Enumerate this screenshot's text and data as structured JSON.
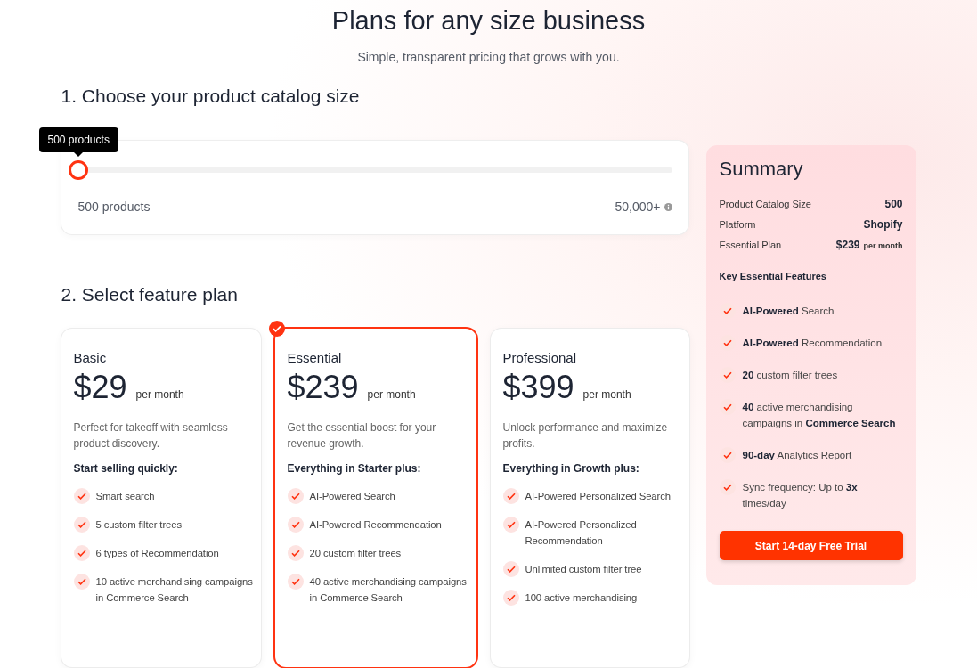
{
  "header": {
    "title": "Plans for any size business",
    "subtitle": "Simple, transparent pricing that grows with you."
  },
  "catalog": {
    "heading": "1. Choose your product catalog size",
    "tooltip": "500 products",
    "level": 0,
    "min_label": "500 products",
    "max_label": "50,000+"
  },
  "plan_section": {
    "heading": "2. Select feature plan"
  },
  "plans": [
    {
      "name": "Basic",
      "price": "$29",
      "period": "per month",
      "description": "Perfect for takeoff with seamless product discovery.",
      "features_title": "Start selling quickly:",
      "selected": false,
      "features": [
        "Smart search",
        "5 custom filter trees",
        "6 types of Recommendation",
        "10 active merchandising campaigns in Commerce Search"
      ]
    },
    {
      "name": "Essential",
      "price": "$239",
      "period": "per month",
      "description": "Get the essential boost for your revenue growth.",
      "features_title": "Everything in Starter plus:",
      "selected": true,
      "features": [
        "AI-Powered Search",
        "AI-Powered Recommendation",
        "20 custom filter trees",
        "40 active merchandising campaigns in Commerce Search"
      ]
    },
    {
      "name": "Professional",
      "price": "$399",
      "period": "per month",
      "description": "Unlock performance and maximize profits.",
      "features_title": "Everything in Growth plus:",
      "selected": false,
      "features": [
        "AI-Powered Personalized Search",
        "AI-Powered Personalized Recommendation",
        "Unlimited custom filter tree",
        "100 active merchandising"
      ]
    }
  ],
  "summary": {
    "title": "Summary",
    "rows": [
      {
        "label": "Product Catalog Size",
        "value": "500"
      },
      {
        "label": "Platform",
        "value": "Shopify"
      },
      {
        "label": "Essential Plan",
        "value": "$239",
        "unit": "per month"
      }
    ],
    "features_title": "Key Essential Features",
    "features": [
      "**AI-Powered** Search",
      "**AI-Powered** Recommendation",
      "**20** custom filter trees",
      "**40** active merchandising campaigns in **Commerce Search**",
      "**90-day** Analytics Report",
      "Sync frequency: Up to **3x** times/day"
    ],
    "button": "Start 14-day Free Trial"
  }
}
